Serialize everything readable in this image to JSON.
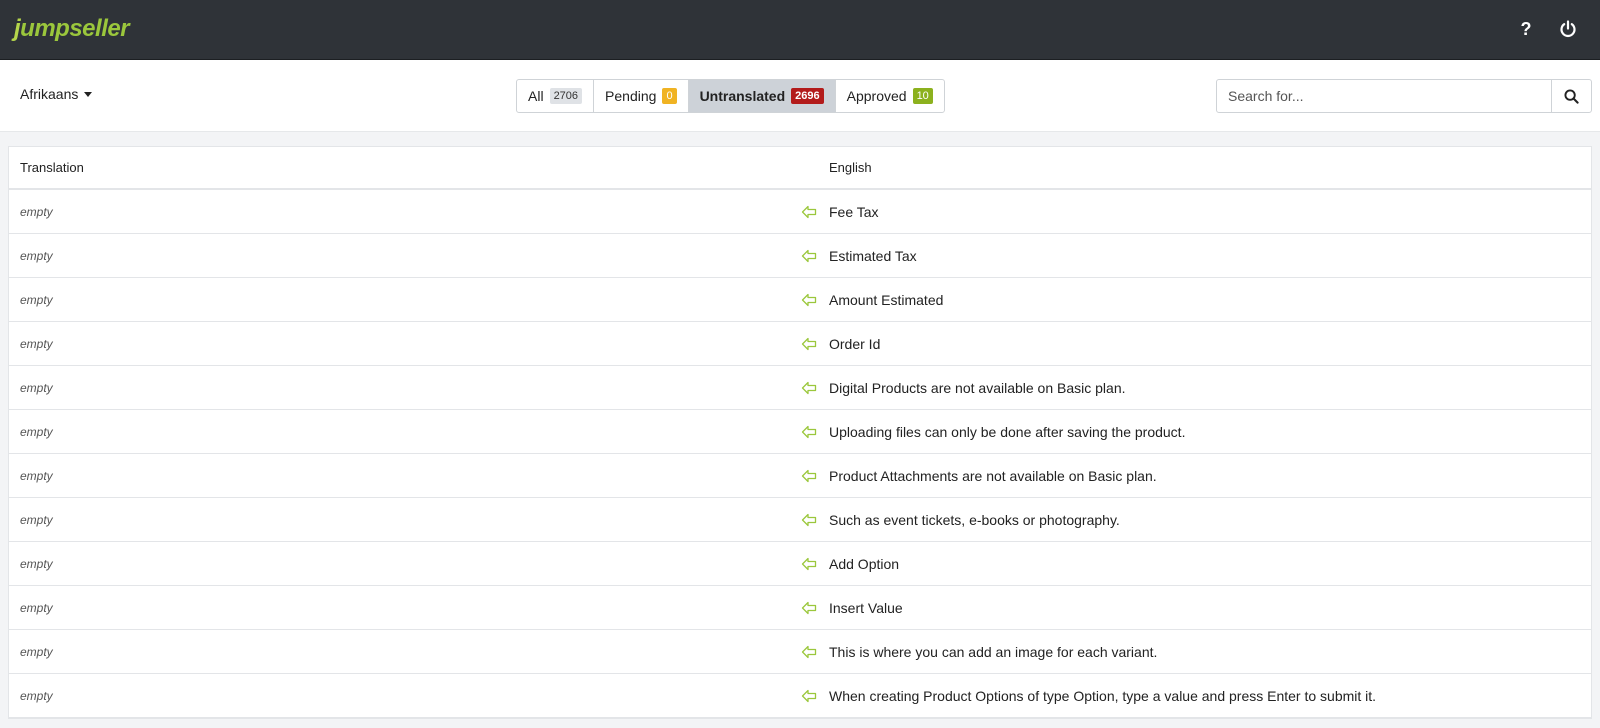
{
  "brand": {
    "name_j": "j",
    "name_rest": "umpseller"
  },
  "header": {
    "help_icon": "question-mark-icon",
    "power_icon": "power-icon"
  },
  "language": {
    "selected": "Afrikaans"
  },
  "filters": [
    {
      "label": "All",
      "count": "2706",
      "color": "#dfe2e6"
    },
    {
      "label": "Pending",
      "count": "0",
      "color": "#f0b323"
    },
    {
      "label": "Untranslated",
      "count": "2696",
      "color": "#b31b1b",
      "active": true
    },
    {
      "label": "Approved",
      "count": "10",
      "color": "#8cb11e"
    }
  ],
  "search": {
    "placeholder": "Search for..."
  },
  "table": {
    "columns": {
      "translation": "Translation",
      "english": "English"
    },
    "empty_label": "empty",
    "rows": [
      "Fee Tax",
      "Estimated Tax",
      "Amount Estimated",
      "Order Id",
      "Digital Products are not available on Basic plan.",
      "Uploading files can only be done after saving the product.",
      "Product Attachments are not available on Basic plan.",
      "Such as event tickets, e-books or photography.",
      "Add Option",
      "Insert Value",
      "This is where you can add an image for each variant.",
      "When creating Product Options of type Option, type a value and press Enter to submit it."
    ]
  },
  "colors": {
    "accent_green": "#9bc73c",
    "topbar": "#2f3338"
  }
}
